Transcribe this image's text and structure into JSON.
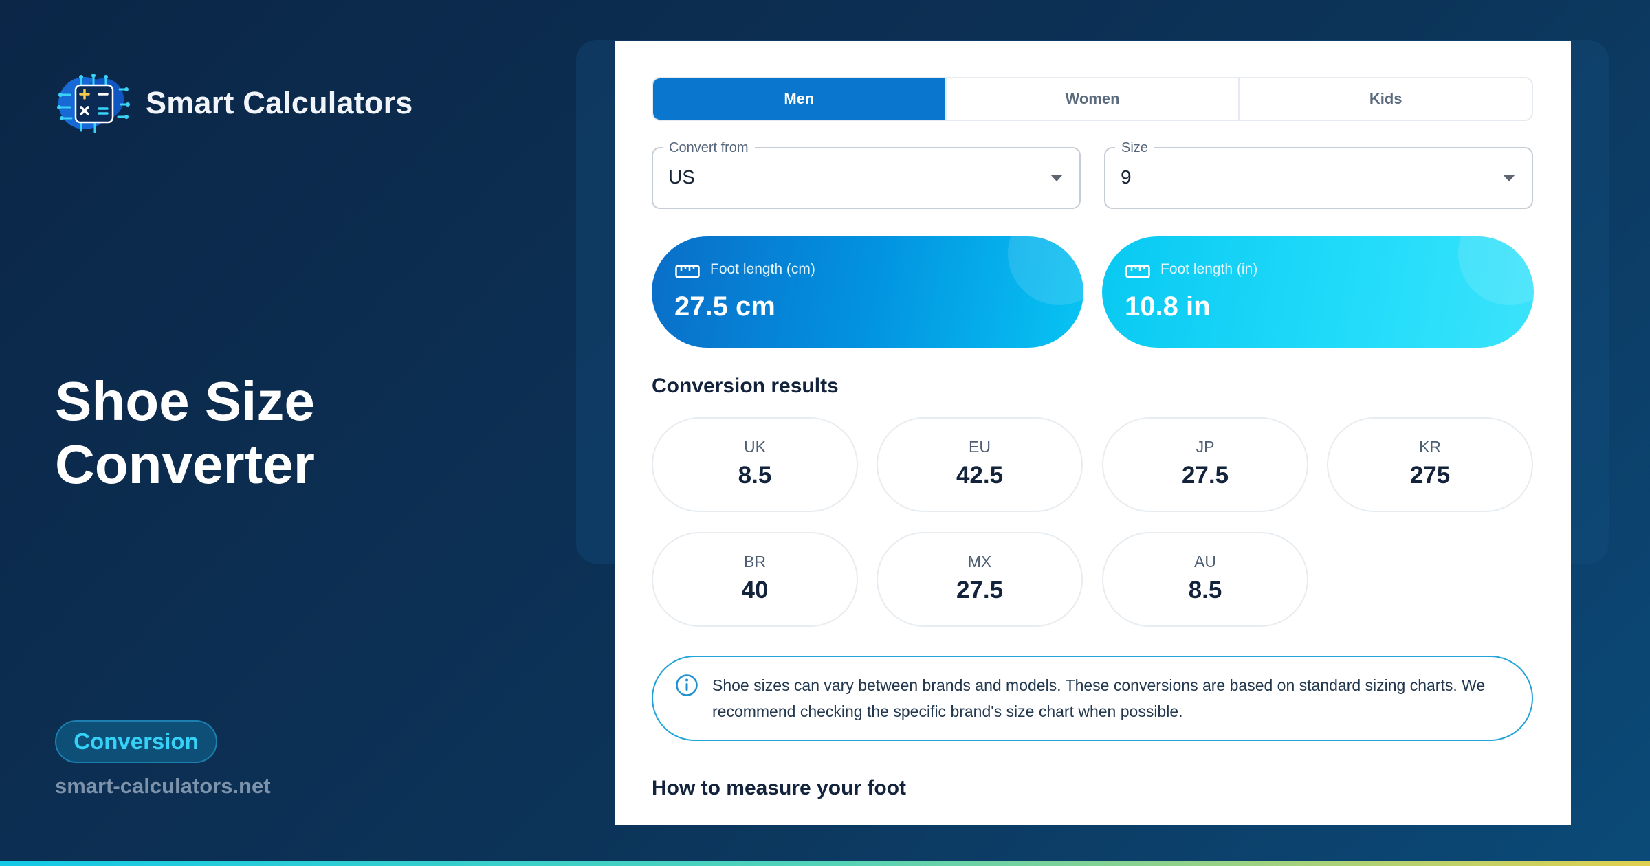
{
  "brand": {
    "name": "Smart Calculators",
    "logo_icon": "calculator-chip-logo"
  },
  "hero": {
    "title": "Shoe Size Converter"
  },
  "category_tag": "Conversion",
  "site_url": "smart-calculators.net",
  "tabs": [
    {
      "label": "Men",
      "active": true
    },
    {
      "label": "Women",
      "active": false
    },
    {
      "label": "Kids",
      "active": false
    }
  ],
  "convert_from": {
    "label": "Convert from",
    "value": "US"
  },
  "size": {
    "label": "Size",
    "value": "9"
  },
  "foot_length": {
    "cm": {
      "label": "Foot length (cm)",
      "value": "27.5 cm",
      "icon": "ruler-icon"
    },
    "in": {
      "label": "Foot length (in)",
      "value": "10.8 in",
      "icon": "ruler-icon"
    }
  },
  "results": {
    "title": "Conversion results",
    "items": [
      {
        "code": "UK",
        "value": "8.5"
      },
      {
        "code": "EU",
        "value": "42.5"
      },
      {
        "code": "JP",
        "value": "27.5"
      },
      {
        "code": "KR",
        "value": "275"
      },
      {
        "code": "BR",
        "value": "40"
      },
      {
        "code": "MX",
        "value": "27.5"
      },
      {
        "code": "AU",
        "value": "8.5"
      }
    ]
  },
  "info": {
    "icon": "info-icon",
    "text": "Shoe sizes can vary between brands and models. These conversions are based on standard sizing charts. We recommend checking the specific brand's size chart when possible."
  },
  "how_to": {
    "title": "How to measure your foot"
  },
  "colors": {
    "accent": "#0a76cd",
    "cyan": "#08c4f3",
    "background": "#0b2647"
  }
}
